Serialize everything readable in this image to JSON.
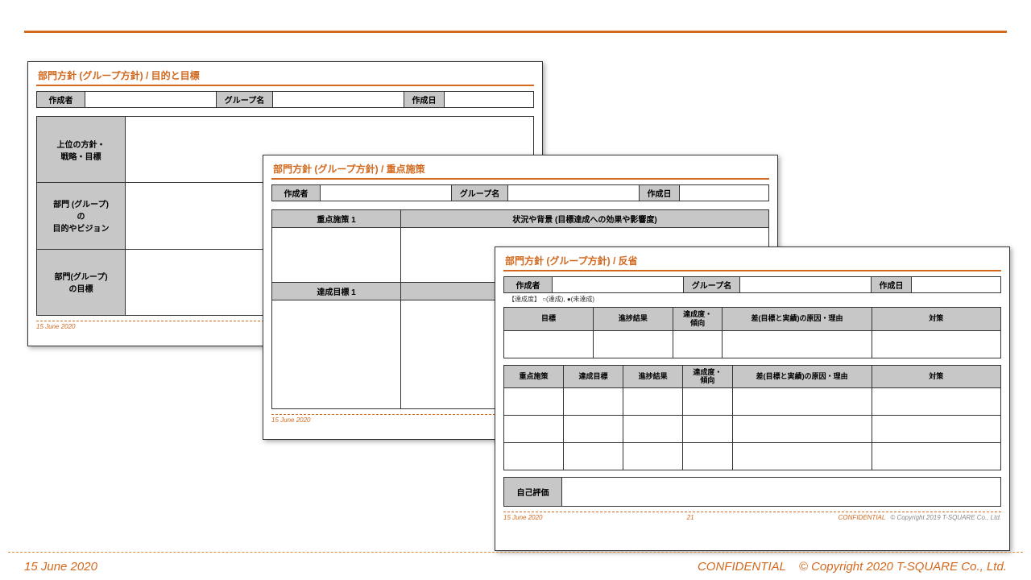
{
  "footer": {
    "date": "15 June 2020",
    "confidential": "CONFIDENTIAL",
    "copyright": "© Copyright 2020 T-SQUARE Co., Ltd."
  },
  "sheet1": {
    "title": "部門方針 (グループ方針) / 目的と目標",
    "hdr": {
      "author_lbl": "作成者",
      "group_lbl": "グループ名",
      "date_lbl": "作成日"
    },
    "rows": {
      "r1": "上位の方針・\n戦略・目標",
      "r2": "部門 (グループ)\nの\n目的やビジョン",
      "r3": "部門(グループ)\nの目標"
    },
    "foot_date": "15 June 2020"
  },
  "sheet2": {
    "title": "部門方針 (グループ方針) / 重点施策",
    "hdr": {
      "author_lbl": "作成者",
      "group_lbl": "グループ名",
      "date_lbl": "作成日"
    },
    "colA1": "重点施策 1",
    "colB1": "状況や背景 (目標達成への効果や影響度)",
    "colA2": "達成目標 1",
    "foot_date": "15 June 2020"
  },
  "sheet3": {
    "title": "部門方針 (グループ方針) / 反省",
    "hdr": {
      "author_lbl": "作成者",
      "group_lbl": "グループ名",
      "date_lbl": "作成日"
    },
    "legend": "【達成度】 ○(達成), ●(未達成)",
    "t1": {
      "c1": "目標",
      "c2": "進捗結果",
      "c3": "達成度・\n傾向",
      "c4": "差(目標と実績)の原因・理由",
      "c5": "対策"
    },
    "t2": {
      "c1": "重点施策",
      "c2": "達成目標",
      "c3": "進捗結果",
      "c4": "達成度・\n傾向",
      "c5": "差(目標と実績)の原因・理由",
      "c6": "対策"
    },
    "selfeval": "自己評価",
    "foot": {
      "date": "15 June 2020",
      "page": "21",
      "conf": "CONFIDENTIAL",
      "copy": "© Copyright 2019 T-SQUARE Co., Ltd."
    }
  }
}
